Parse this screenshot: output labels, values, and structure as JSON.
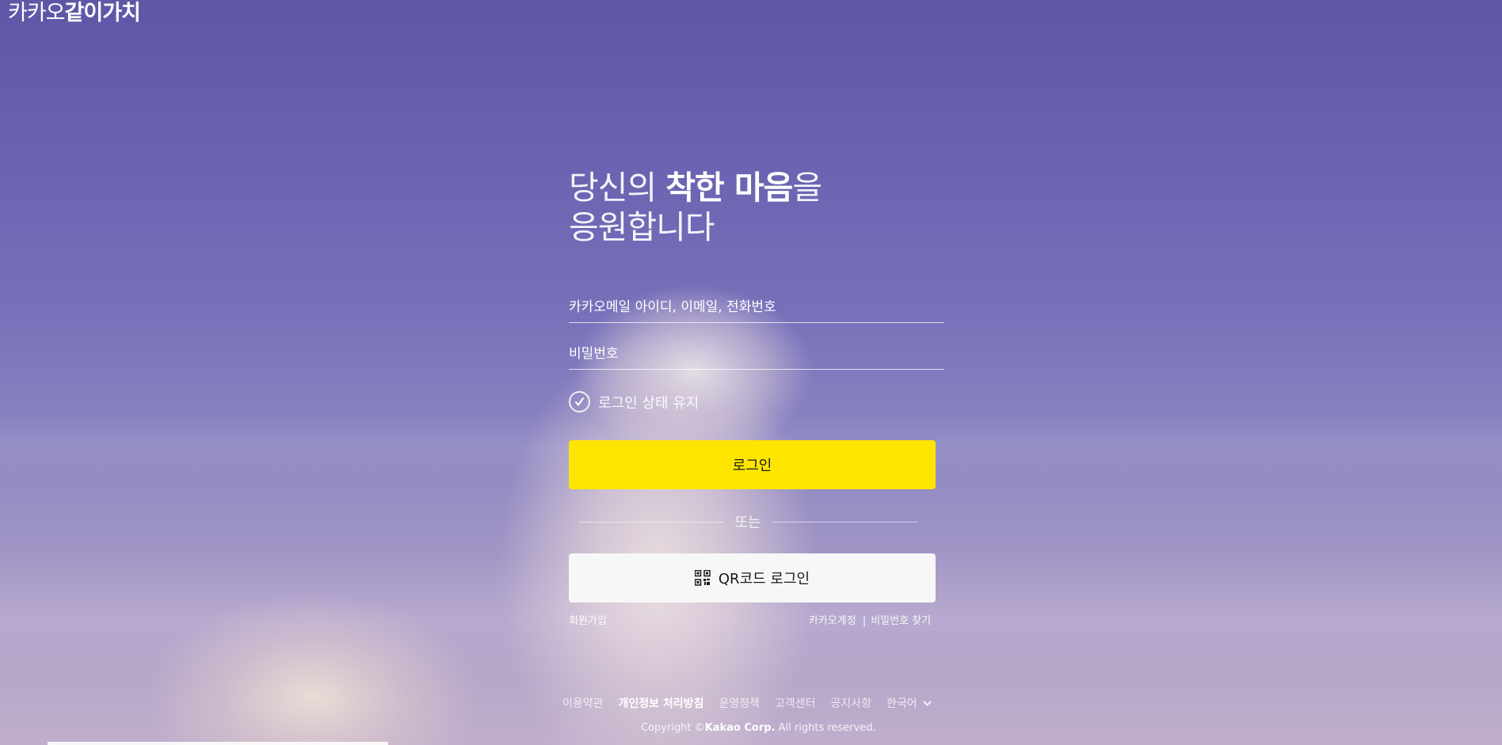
{
  "logo": {
    "light": "카카오",
    "bold": "같이가치"
  },
  "headline": {
    "line1_prefix": "당신의 ",
    "line1_bold": "착한 마음",
    "line1_suffix": "을",
    "line2": "응원합니다"
  },
  "form": {
    "id_placeholder": "카카오메일 아이디, 이메일, 전화번호",
    "password_placeholder": "비밀번호",
    "keep_login_label": "로그인 상태 유지",
    "login_button": "로그인",
    "or_text": "또는",
    "qr_button": "QR코드 로그인",
    "signup_link": "회원가입",
    "account_link": "카카오계정",
    "find_password_link": "비밀번호 찾기",
    "link_separator": "|"
  },
  "footer": {
    "links": [
      "이용약관",
      "개인정보 처리방침",
      "운영정책",
      "고객센터",
      "공지사항"
    ],
    "language": "한국어",
    "copyright_prefix": "Copyright ©",
    "copyright_company": "Kakao Corp.",
    "copyright_suffix": " All rights reserved."
  },
  "colors": {
    "login_button": "#fee500",
    "qr_button": "#f7f7f7",
    "text_dark": "#191919"
  },
  "icons": [
    "check-icon",
    "qr-code-icon",
    "chevron-down-icon"
  ]
}
